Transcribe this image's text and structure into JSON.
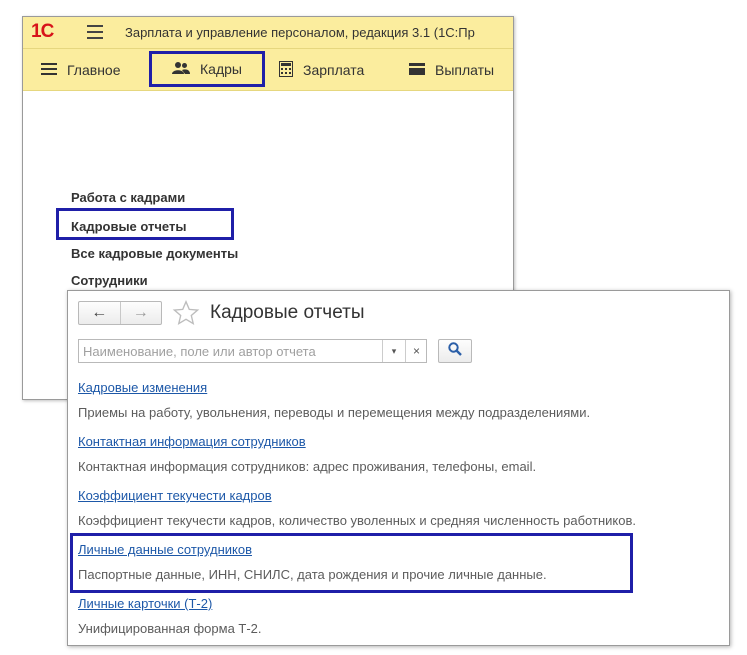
{
  "app": {
    "logo": "1С",
    "title": "Зарплата и управление персоналом, редакция 3.1  (1С:Пр"
  },
  "nav": {
    "items": [
      {
        "label": "Главное",
        "icon": "menu-icon"
      },
      {
        "label": "Кадры",
        "icon": "people-icon"
      },
      {
        "label": "Зарплата",
        "icon": "calculator-icon"
      },
      {
        "label": "Выплаты",
        "icon": "wallet-icon"
      }
    ],
    "active": "Кадры"
  },
  "sections": [
    {
      "label": "Работа с кадрами"
    },
    {
      "label": "Кадровые отчеты"
    },
    {
      "label": "Все кадровые документы"
    },
    {
      "label": "Сотрудники"
    }
  ],
  "reports_window": {
    "title": "Кадровые отчеты",
    "back": "←",
    "forward": "→",
    "search_placeholder": "Наименование, поле или автор отчета",
    "dropdown_glyph": "▾",
    "clear_glyph": "×",
    "items": [
      {
        "title": "Кадровые изменения",
        "description": "Приемы на работу, увольнения, переводы и перемещения между подразделениями."
      },
      {
        "title": "Контактная информация сотрудников",
        "description": "Контактная информация сотрудников: адрес проживания, телефоны, email."
      },
      {
        "title": "Коэффициент текучести кадров",
        "description": "Коэффициент текучести кадров, количество уволенных и средняя численность работников."
      },
      {
        "title": "Личные данные сотрудников",
        "description": "Паспортные данные, ИНН, СНИЛС, дата рождения и прочие личные данные."
      },
      {
        "title": "Личные карточки (Т-2)",
        "description": "Унифицированная форма Т-2."
      }
    ]
  },
  "colors": {
    "header_bg": "#fbed9e",
    "logo_red": "#d7141a",
    "highlight_box": "#1f1fa8",
    "link": "#1d58a8"
  }
}
